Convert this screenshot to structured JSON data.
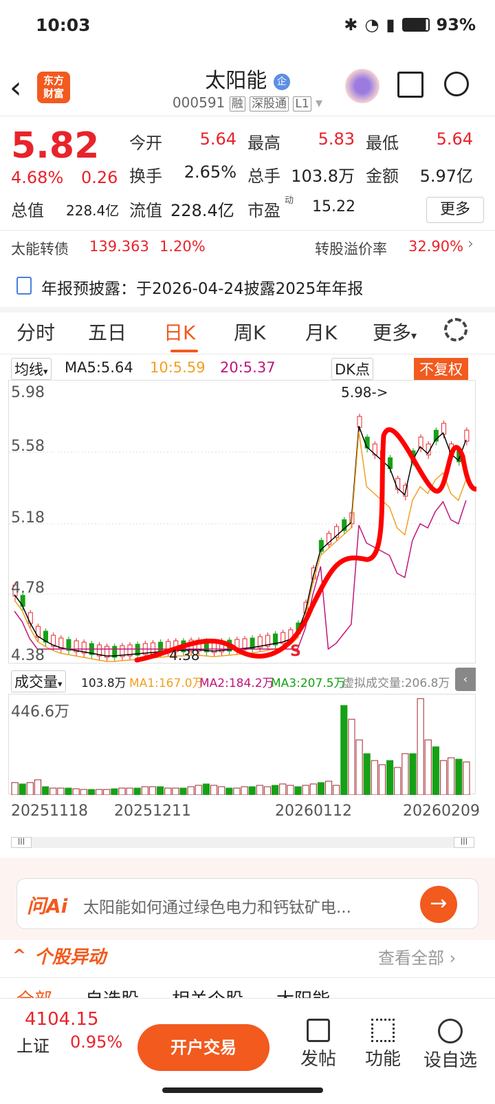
{
  "status": {
    "time": "10:03",
    "battery": "93%"
  },
  "header": {
    "logo_line1": "东方",
    "logo_line2": "财富",
    "name": "太阳能",
    "code": "000591",
    "tag_margin": "融",
    "tag_connect": "深股通",
    "tag_level": "L1"
  },
  "quote": {
    "price": "5.82",
    "change_pct": "4.68%",
    "change": "0.26",
    "open_label": "今开",
    "open": "5.64",
    "high_label": "最高",
    "high": "5.83",
    "low_label": "最低",
    "low": "5.64",
    "turnover_label": "换手",
    "turnover": "2.65%",
    "volume_label": "总手",
    "volume": "103.8万",
    "amount_label": "金额",
    "amount": "5.97亿",
    "mktcap_label": "总值",
    "mktcap": "228.4亿",
    "float_label": "流值",
    "float": "228.4亿",
    "pe_label": "市盈",
    "pe_sup": "动",
    "pe": "15.22",
    "more": "更多"
  },
  "bond": {
    "label": "太能转债",
    "price": "139.363",
    "pct": "1.20%",
    "premium_label": "转股溢价率",
    "premium": "32.90%"
  },
  "notice": {
    "text": "年报预披露：于2026-04-24披露2025年年报"
  },
  "tabs": [
    "分时",
    "五日",
    "日K",
    "周K",
    "月K",
    "更多"
  ],
  "chart_header": {
    "ma_btn": "均线",
    "ma5": "MA5:5.64",
    "ma10": "10:5.59",
    "ma20": "20:5.37",
    "dk": "DK点",
    "adjust": "不复权"
  },
  "chart_labels": {
    "p1": "5.98",
    "p2": "5.58",
    "p3": "5.18",
    "p4": "4.78",
    "p5": "4.38",
    "max_note": "5.98->",
    "min_note": "4.38",
    "s_mark": "S"
  },
  "volume_header": {
    "btn": "成交量",
    "vol": "103.8万",
    "ma1": "MA1:167.0万",
    "ma2": "MA2:184.2万",
    "ma3": "MA3:207.5万",
    "virtual": "虚拟成交量:206.8万",
    "max": "446.6万"
  },
  "dates": [
    "20251118",
    "20251211",
    "20260112",
    "20260209"
  ],
  "ai": {
    "logo": "问Ai",
    "text": "太阳能如何通过绿色电力和钙钛矿电..."
  },
  "movement": {
    "title": "个股异动",
    "view_all": "查看全部"
  },
  "subtabs": [
    "全部",
    "自选股",
    "相关个股",
    "太阳能"
  ],
  "bottom": {
    "index_value": "4104.15",
    "index_name": "上证",
    "index_pct": "0.95%",
    "open_account": "开户交易",
    "post": "发帖",
    "func": "功能",
    "watch": "设自选"
  },
  "colors": {
    "accent": "#f25a1e",
    "up": "#e8232b",
    "down": "#15a115"
  },
  "chart_data": {
    "type": "candlestick",
    "y_range": [
      4.38,
      5.98
    ],
    "ma_colors": {
      "ma5": "#000000",
      "ma10": "#f0a020",
      "ma20": "#c0157a"
    }
  }
}
